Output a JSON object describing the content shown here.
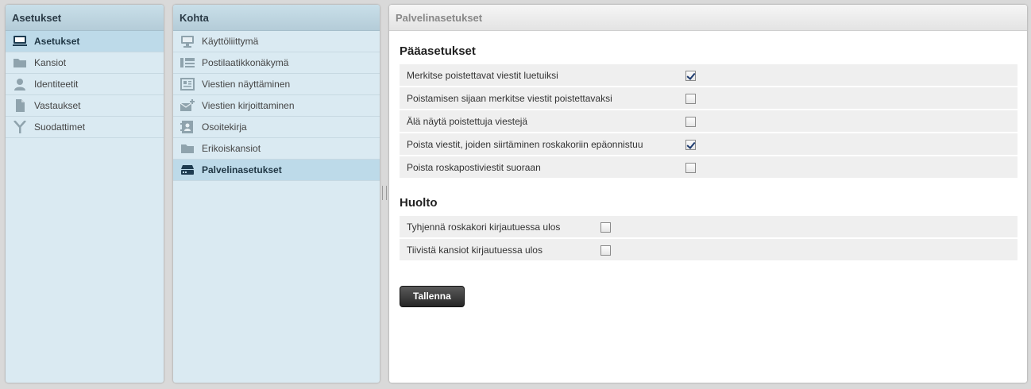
{
  "left_panel": {
    "title": "Asetukset",
    "items": [
      {
        "label": "Asetukset",
        "icon": "monitor-icon",
        "selected": true
      },
      {
        "label": "Kansiot",
        "icon": "folder-icon"
      },
      {
        "label": "Identiteetit",
        "icon": "user-icon"
      },
      {
        "label": "Vastaukset",
        "icon": "document-icon"
      },
      {
        "label": "Suodattimet",
        "icon": "filter-icon"
      }
    ]
  },
  "mid_panel": {
    "title": "Kohta",
    "items": [
      {
        "label": "Käyttöliittymä",
        "icon": "monitor-icon"
      },
      {
        "label": "Postilaatikkonäkymä",
        "icon": "mailbox-view-icon"
      },
      {
        "label": "Viestien näyttäminen",
        "icon": "message-view-icon"
      },
      {
        "label": "Viestien kirjoittaminen",
        "icon": "compose-icon"
      },
      {
        "label": "Osoitekirja",
        "icon": "addressbook-icon"
      },
      {
        "label": "Erikoiskansiot",
        "icon": "folder-icon"
      },
      {
        "label": "Palvelinasetukset",
        "icon": "server-icon",
        "selected": true
      }
    ]
  },
  "right_panel": {
    "title": "Palvelinasetukset",
    "main_section": {
      "title": "Pääasetukset",
      "rows": [
        {
          "label": "Merkitse poistettavat viestit luetuiksi",
          "checked": true
        },
        {
          "label": "Poistamisen sijaan merkitse viestit poistettavaksi",
          "checked": false
        },
        {
          "label": "Älä näytä poistettuja viestejä",
          "checked": false
        },
        {
          "label": "Poista viestit, joiden siirtäminen roskakoriin epäonnistuu",
          "checked": true
        },
        {
          "label": "Poista roskapostiviestit suoraan",
          "checked": false
        }
      ]
    },
    "maintenance_section": {
      "title": "Huolto",
      "rows": [
        {
          "label": "Tyhjennä roskakori kirjautuessa ulos",
          "checked": false
        },
        {
          "label": "Tiivistä kansiot kirjautuessa ulos",
          "checked": false
        }
      ]
    },
    "save_label": "Tallenna"
  },
  "colors": {
    "panel_bg": "#daeaf2",
    "selected_bg": "#bddae9",
    "button_bg": "#262626"
  }
}
